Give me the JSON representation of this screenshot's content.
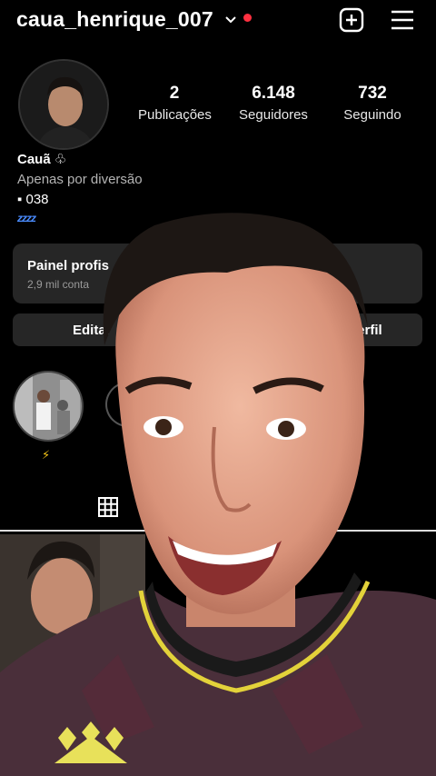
{
  "header": {
    "username": "caua_henrique_007"
  },
  "stats": [
    {
      "value": "2",
      "label": "Publicações"
    },
    {
      "value": "6.148",
      "label": "Seguidores"
    },
    {
      "value": "732",
      "label": "Seguindo"
    }
  ],
  "profile": {
    "name": "Cauã ♧",
    "bio_line1": "Apenas por diversão",
    "bio_line2": "▪ 038",
    "bio_line3": "zzzz"
  },
  "panel": {
    "title": "Painel profis",
    "subtitle": "2,9 mil conta"
  },
  "edit": {
    "left": "Editar",
    "right": "perfil"
  },
  "highlight": {
    "label": "⚡"
  },
  "colors": {
    "background": "#000000",
    "card": "#262626",
    "notification_dot": "#ff3040",
    "bio_link": "#4a8cff"
  },
  "icons": [
    "chevron-down-icon",
    "new-post-icon",
    "menu-icon",
    "grid-icon"
  ]
}
